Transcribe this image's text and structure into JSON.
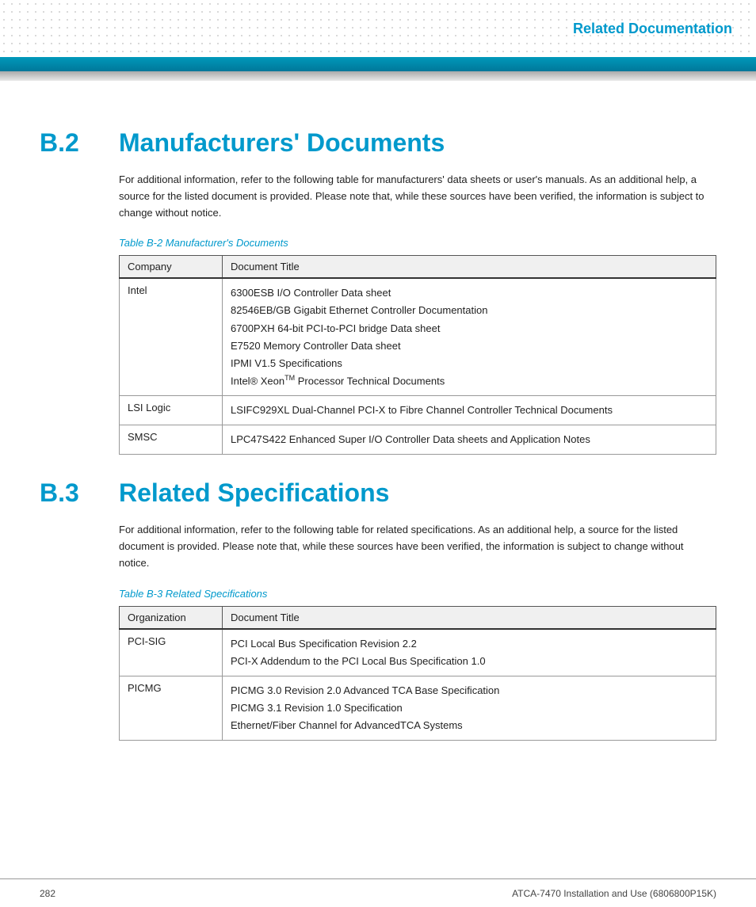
{
  "header": {
    "title": "Related Documentation"
  },
  "sections": [
    {
      "id": "b2",
      "number": "B.2",
      "title": "Manufacturers' Documents",
      "body": "For additional information, refer to the following table for manufacturers' data sheets or user's manuals. As an additional help, a source for the listed document is provided. Please note that, while these sources have been verified, the information is subject to change without notice.",
      "table_caption": "Table B-2 Manufacturer's Documents",
      "table": {
        "col1_header": "Company",
        "col2_header": "Document Title",
        "rows": [
          {
            "col1": "Intel",
            "col2_items": [
              "6300ESB I/O Controller Data sheet",
              "82546EB/GB Gigabit Ethernet Controller Documentation",
              "6700PXH 64-bit PCI-to-PCI bridge Data sheet",
              "E7520 Memory Controller Data sheet",
              "IPMI V1.5 Specifications",
              "Intel® Xeon™ Processor Technical Documents"
            ]
          },
          {
            "col1": "LSI Logic",
            "col2_items": [
              "LSIFC929XL Dual-Channel PCI-X to Fibre Channel Controller Technical Documents"
            ]
          },
          {
            "col1": "SMSC",
            "col2_items": [
              "LPC47S422 Enhanced Super I/O Controller Data sheets and Application Notes"
            ]
          }
        ]
      }
    },
    {
      "id": "b3",
      "number": "B.3",
      "title": "Related Specifications",
      "body": "For additional information, refer to the following table for related specifications. As an additional help, a source for the listed document is provided. Please note that, while these sources have been verified, the information is subject to change without notice.",
      "table_caption": "Table B-3 Related Specifications",
      "table": {
        "col1_header": "Organization",
        "col2_header": "Document Title",
        "rows": [
          {
            "col1": "PCI-SIG",
            "col2_items": [
              "PCI Local Bus Specification Revision 2.2",
              "PCI-X Addendum to the PCI Local Bus Specification 1.0"
            ]
          },
          {
            "col1": "PICMG",
            "col2_items": [
              "PICMG 3.0 Revision 2.0 Advanced TCA Base Specification",
              "PICMG 3.1 Revision 1.0 Specification",
              "Ethernet/Fiber Channel for AdvancedTCA Systems"
            ]
          }
        ]
      }
    }
  ],
  "footer": {
    "page_number": "282",
    "doc_title": "ATCA-7470 Installation and Use (6806800P15K)"
  },
  "intel_xeon_tm": "TM"
}
